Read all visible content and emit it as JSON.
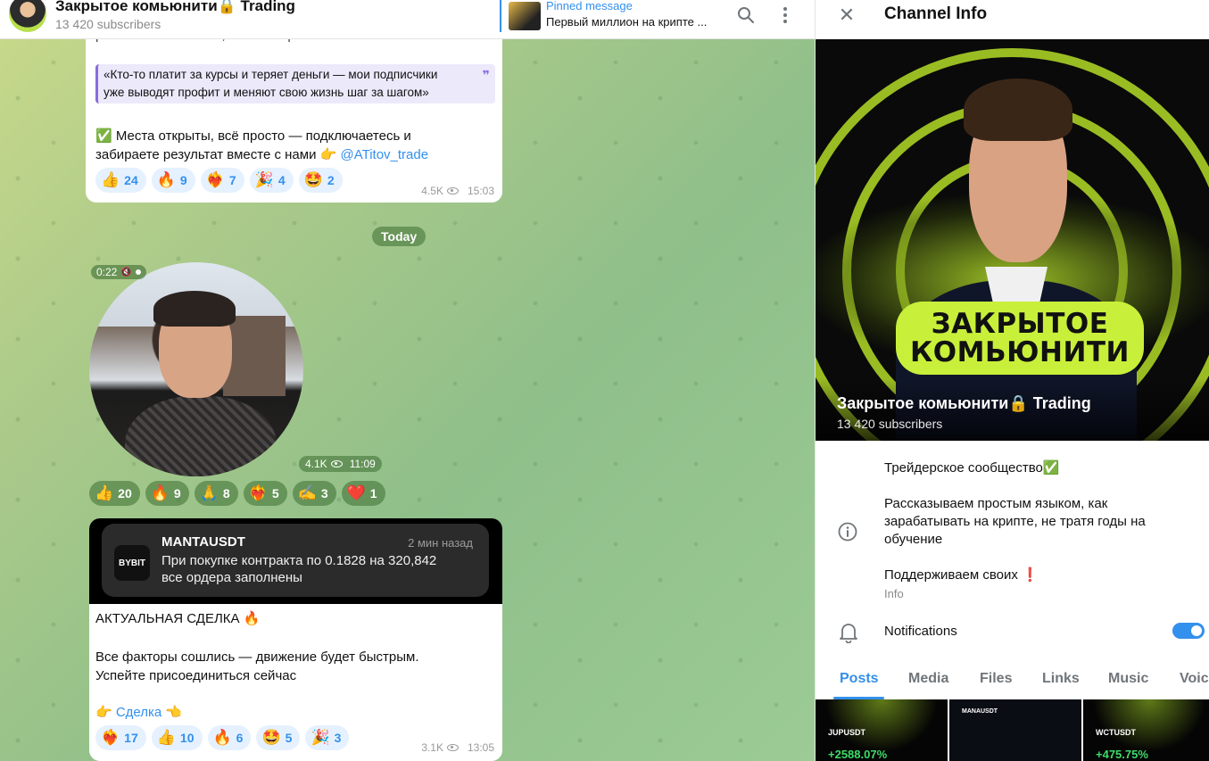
{
  "header": {
    "channel_title": "Закрытое комьюнити🔒 Trading",
    "subscribers": "13 420 subscribers",
    "pinned_label": "Pinned message",
    "pinned_text": "Первый миллион на крипте ..."
  },
  "messages": {
    "first": {
      "cut_text": "работе в пенимании, что и как работает",
      "quote": [
        "«Кто-то платит за курсы и теряет деньги — мои подписчики",
        "уже выводят профит и меняют свою жизнь шаг за шагом»"
      ],
      "line1": "✅ Места открыты, всё просто — подключаетесь и",
      "line2": "забираете результат вместе с нами 👉",
      "link": "@ATitov_trade",
      "reactions": [
        {
          "emoji": "👍",
          "count": "24"
        },
        {
          "emoji": "🔥",
          "count": "9"
        },
        {
          "emoji": "❤️‍🔥",
          "count": "7"
        },
        {
          "emoji": "🎉",
          "count": "4"
        },
        {
          "emoji": "🤩",
          "count": "2"
        }
      ],
      "views": "4.5K",
      "time": "15:03"
    },
    "date_separator": "Today",
    "video": {
      "duration": "0:22",
      "views": "4.1K",
      "time": "11:09",
      "reactions": [
        {
          "emoji": "👍",
          "count": "20"
        },
        {
          "emoji": "🔥",
          "count": "9"
        },
        {
          "emoji": "🙏",
          "count": "8"
        },
        {
          "emoji": "❤️‍🔥",
          "count": "5"
        },
        {
          "emoji": "✍️",
          "count": "3"
        },
        {
          "emoji": "❤️",
          "count": "1"
        }
      ]
    },
    "deal": {
      "card_logo": "BYBIT",
      "card_title": "MANTAUSDT",
      "card_time": "2 мин назад",
      "card_line1": "При покупке контракта по 0.1828 на 320,842",
      "card_line2": "все ордера заполнены",
      "heading": "АКТУАЛЬНАЯ СДЕЛКА 🔥",
      "body1": "Все факторы сошлись — движение будет быстрым.",
      "body2": "Успейте присоединиться сейчас",
      "link": "👉 Сделка 👈",
      "reactions": [
        {
          "emoji": "❤️‍🔥",
          "count": "17"
        },
        {
          "emoji": "👍",
          "count": "10"
        },
        {
          "emoji": "🔥",
          "count": "6"
        },
        {
          "emoji": "🤩",
          "count": "5"
        },
        {
          "emoji": "🎉",
          "count": "3"
        }
      ],
      "views": "3.1K",
      "time": "13:05"
    }
  },
  "panel": {
    "title": "Channel Info",
    "cover_line1": "ЗАКРЫТОЕ",
    "cover_line2": "КОМЬЮНИТИ",
    "name": "Закрытое комьюнити🔒 Trading",
    "subscribers": "13 420 subscribers",
    "info_lines": [
      "Трейдерское сообщество✅",
      "Рассказываем простым языком, как",
      "зарабатывать на крипте, не тратя годы на",
      "обучение",
      "Поддерживаем своих ❗"
    ],
    "info_caption": "Info",
    "notifications_label": "Notifications",
    "notifications_on": true,
    "tabs": [
      "Posts",
      "Media",
      "Files",
      "Links",
      "Music",
      "Voice"
    ],
    "thumbs": [
      {
        "symbol": "JUPUSDT",
        "pct": "+2588.07%"
      },
      {
        "symbol": "MANAUSDT",
        "pct": ""
      },
      {
        "symbol": "WCTUSDT",
        "pct": "+475.75%"
      }
    ],
    "accent": "#3390ec"
  }
}
